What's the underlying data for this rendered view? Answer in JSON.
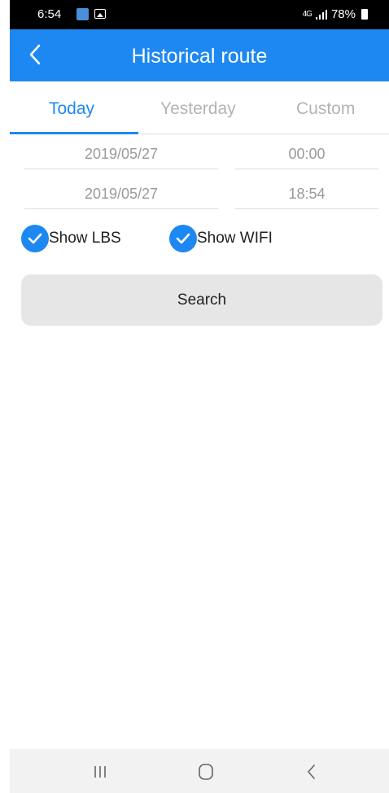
{
  "status_bar": {
    "time": "6:54",
    "signal": "4G",
    "battery": "78%"
  },
  "app_bar": {
    "title": "Historical route",
    "back_icon": "chevron-left-icon"
  },
  "tabs": [
    {
      "label": "Today",
      "active": true
    },
    {
      "label": "Yesterday",
      "active": false
    },
    {
      "label": "Custom",
      "active": false
    }
  ],
  "range": {
    "start_date": "2019/05/27",
    "start_time": "00:00",
    "end_date": "2019/05/27",
    "end_time": "18:54"
  },
  "options": {
    "show_lbs": {
      "label": "Show LBS",
      "checked": true
    },
    "show_wifi": {
      "label": "Show WIFI",
      "checked": true
    }
  },
  "search_label": "Search",
  "nav": {
    "recent": "recent-apps-icon",
    "home": "home-icon",
    "back": "back-icon"
  },
  "colors": {
    "accent": "#1e88f2",
    "button_bg": "#e6e6e6",
    "muted_text": "#9a9a9a"
  }
}
